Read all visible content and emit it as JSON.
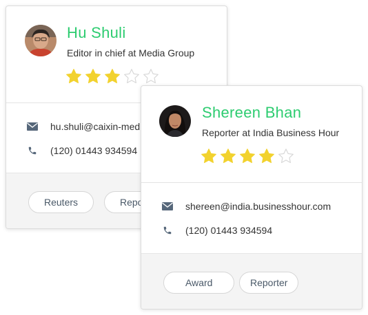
{
  "cards": [
    {
      "name": "Hu Shuli",
      "role": "Editor in chief at Media Group",
      "rating": 3,
      "max_rating": 5,
      "email": "hu.shuli@caixin-media.com",
      "phone": "(120) 01443 934594",
      "tags": [
        "Reuters",
        "Reporter"
      ]
    },
    {
      "name": "Shereen Bhan",
      "role": "Reporter at India Business Hour",
      "rating": 4,
      "max_rating": 5,
      "email": "shereen@india.businesshour.com",
      "phone": "(120) 01443 934594",
      "tags": [
        "Award",
        "Reporter"
      ]
    }
  ],
  "icons": {
    "email": "envelope-icon",
    "phone": "phone-icon",
    "star": "star-icon"
  },
  "colors": {
    "name": "#2dcc70",
    "star_filled": "#f2d22e",
    "star_empty_stroke": "#d8d8d8",
    "icon": "#56677a",
    "footer_bg": "#f4f4f4"
  }
}
